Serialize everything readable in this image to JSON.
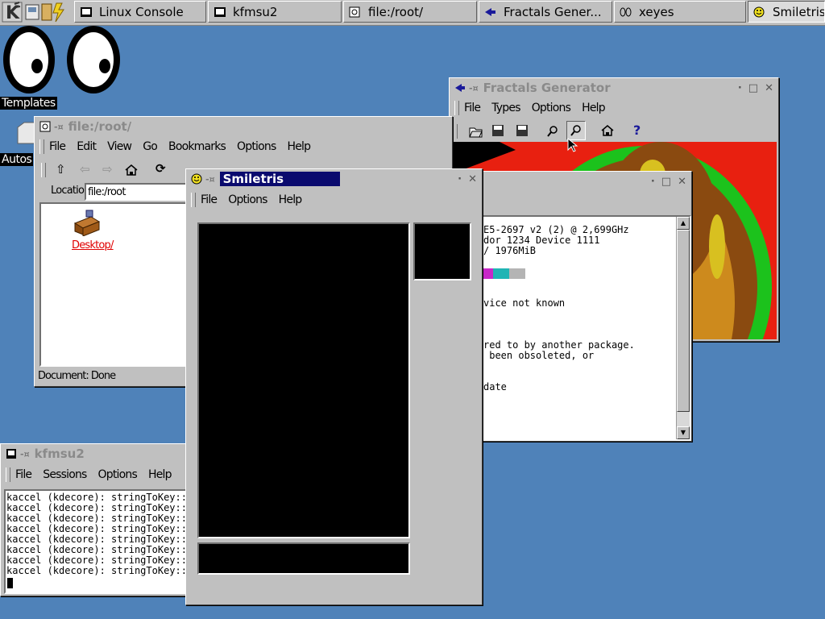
{
  "taskbar": {
    "tasks": [
      {
        "label": "Linux Console",
        "icon": "terminal-icon"
      },
      {
        "label": "kfmsu2",
        "icon": "terminal-icon"
      },
      {
        "label": "file:/root/",
        "icon": "file-manager-icon"
      },
      {
        "label": "Fractals Gener...",
        "icon": "fractal-icon"
      },
      {
        "label": "xeyes",
        "icon": "eyes-icon"
      },
      {
        "label": "Smiletris",
        "icon": "smiley-icon"
      }
    ]
  },
  "desktop": {
    "icons": [
      {
        "label": "Templates"
      },
      {
        "label": "Autos"
      }
    ]
  },
  "filemanager": {
    "title": "file:/root/",
    "menu": [
      "File",
      "Edit",
      "View",
      "Go",
      "Bookmarks",
      "Options",
      "Help"
    ],
    "location_label": "Location:",
    "location_value": "file:/root",
    "item_label": "Desktop/",
    "status": "Document: Done"
  },
  "fractals": {
    "title": "Fractals Generator",
    "menu": [
      "File",
      "Types",
      "Options",
      "Help"
    ],
    "colors": {
      "outer": "#e82010",
      "green": "#1cc21c",
      "brown": "#8a4a10",
      "yellow": "#d8c020"
    }
  },
  "console": {
    "lines": [
      "E5-2697 v2 (2) @ 2,699GHz",
      "dor 1234 Device 1111",
      "/ 1976MiB",
      "",
      "",
      "",
      "",
      "vice not known",
      "",
      "",
      "",
      "red to by another package.",
      " been obsoleted, or",
      "",
      "",
      "date"
    ],
    "swatches": [
      "#c828c8",
      "#20b4b4",
      "#b4b4b4"
    ]
  },
  "kfmsu2": {
    "title": "kfmsu2",
    "menu": [
      "File",
      "Sessions",
      "Options",
      "Help"
    ],
    "lines": [
      "kaccel (kdecore): stringToKey::N",
      "kaccel (kdecore): stringToKey::N",
      "kaccel (kdecore): stringToKey::N",
      "kaccel (kdecore): stringToKey::N",
      "kaccel (kdecore): stringToKey::N",
      "kaccel (kdecore): stringToKey::N",
      "kaccel (kdecore): stringToKey::N",
      "kaccel (kdecore): stringToKey::N"
    ]
  },
  "smiletris": {
    "title": "Smiletris",
    "menu": [
      "File",
      "Options",
      "Help"
    ]
  }
}
